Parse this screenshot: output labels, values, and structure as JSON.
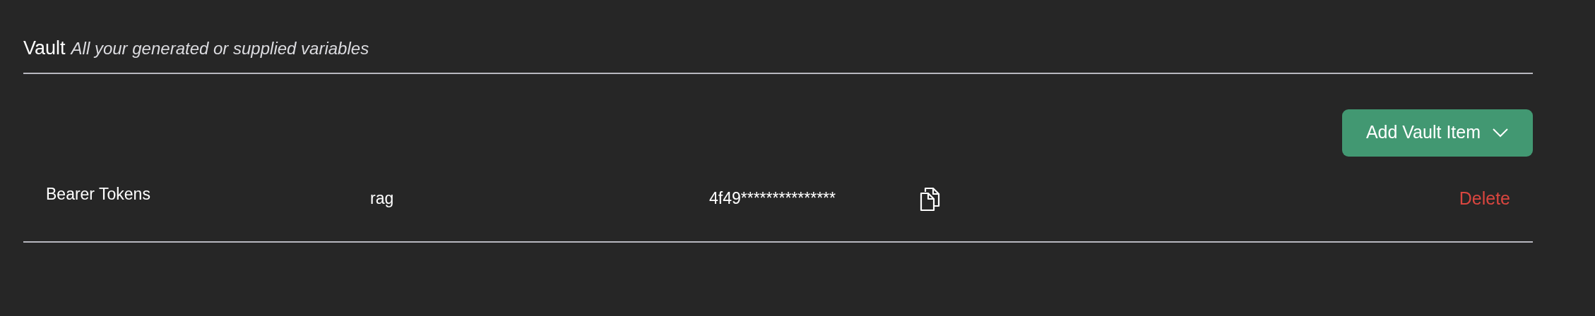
{
  "header": {
    "title": "Vault",
    "subtitle": "All your generated or supplied variables"
  },
  "add_button": {
    "label": "Add Vault Item"
  },
  "items": [
    {
      "type": "Bearer Tokens",
      "name": "rag",
      "value": "4f49***************",
      "delete_label": "Delete"
    }
  ]
}
